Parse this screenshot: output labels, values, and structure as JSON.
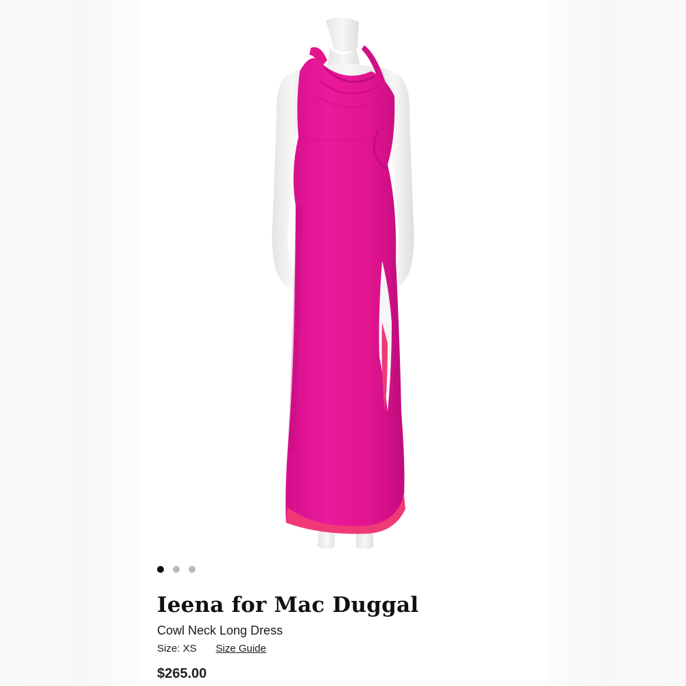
{
  "product": {
    "brand": "Ieena for Mac Duggal",
    "name": "Cowl Neck Long Dress",
    "size_label": "Size: XS",
    "size_guide_label": "Size Guide",
    "price": "$265.00"
  },
  "carousel": {
    "total": 3,
    "active_index": 0
  },
  "colors": {
    "dress": "#e8149a",
    "dress_shadow": "#c70d84",
    "lining": "#f03a78",
    "mannequin": "#f2f2f2"
  }
}
